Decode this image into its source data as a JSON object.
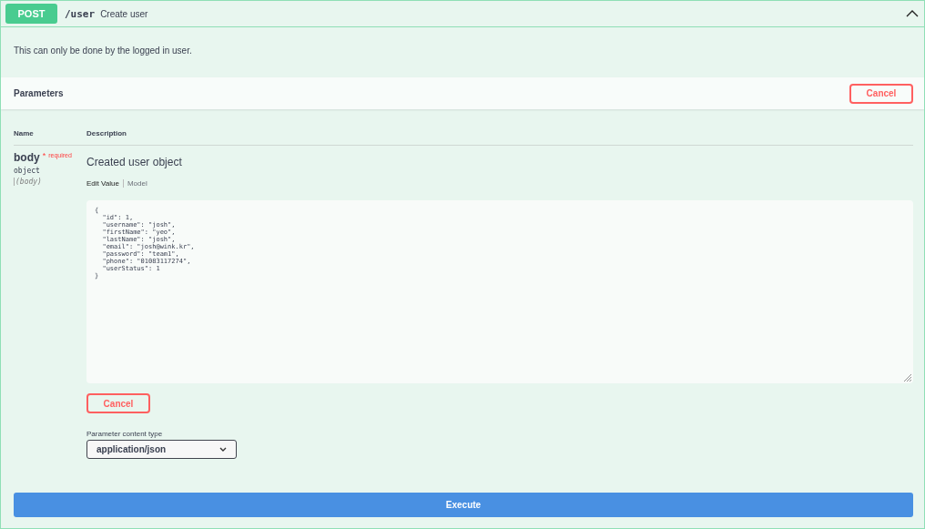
{
  "operation": {
    "method": "POST",
    "path": "/user",
    "summary": "Create user",
    "expanded": true
  },
  "description": "This can only be done by the logged in user.",
  "parameters_header": {
    "title": "Parameters",
    "cancel_button": "Cancel"
  },
  "table": {
    "columns": [
      "Name",
      "Description"
    ],
    "rows": [
      {
        "name": "body",
        "required_mark": "*",
        "required_label": "required",
        "type": "object",
        "location": "(body)",
        "description": "Created user object",
        "tabs": [
          {
            "label": "Edit Value",
            "selected": true
          },
          {
            "label": "Model",
            "selected": false
          }
        ],
        "value": "{\n  \"id\": 1,\n  \"username\": \"josh\",\n  \"firstName\": \"yeo\",\n  \"lastName\": \"josh\",\n  \"email\": \"josh@wink.kr\",\n  \"password\": \"team1\",\n  \"phone\": \"01083117274\",\n  \"userStatus\": 1\n}",
        "cancel_button": "Cancel",
        "content_type_label": "Parameter content type",
        "content_type": "application/json"
      }
    ]
  },
  "execute_button": "Execute"
}
